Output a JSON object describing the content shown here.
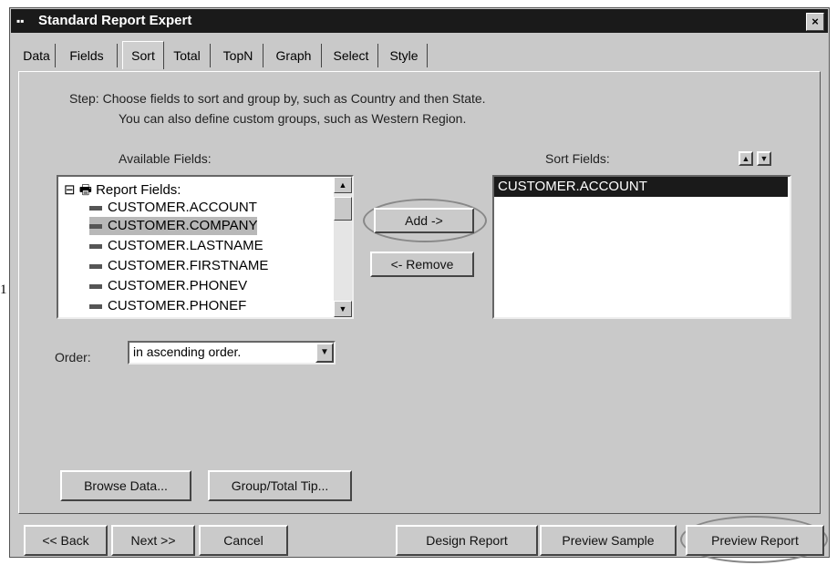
{
  "window": {
    "title": "Standard Report Expert",
    "close_label": "×"
  },
  "tabs": [
    "Data",
    "Fields",
    "Sort",
    "Total",
    "TopN",
    "Graph",
    "Select",
    "Style"
  ],
  "active_tab": "Sort",
  "step_text": {
    "line1": "Step:  Choose fields to sort and group by, such as Country and then State.",
    "line2": "You can also define custom groups, such as Western Region."
  },
  "available_fields": {
    "label": "Available Fields:",
    "root": "Report Fields:",
    "items": [
      "CUSTOMER.ACCOUNT",
      "CUSTOMER.COMPANY",
      "CUSTOMER.LASTNAME",
      "CUSTOMER.FIRSTNAME",
      "CUSTOMER.PHONEV",
      "CUSTOMER.PHONEF"
    ],
    "selected": "CUSTOMER.COMPANY"
  },
  "buttons": {
    "add": "Add ->",
    "remove": "<- Remove"
  },
  "sort_fields": {
    "label": "Sort Fields:",
    "items": [
      "CUSTOMER.ACCOUNT"
    ]
  },
  "order": {
    "label": "Order:",
    "value": "in ascending order."
  },
  "bottom_panel_buttons": {
    "browse": "Browse Data...",
    "group_tip": "Group/Total Tip..."
  },
  "footer": {
    "back": "<< Back",
    "next": "Next >>",
    "cancel": "Cancel",
    "design": "Design Report",
    "preview_sample": "Preview Sample",
    "preview_report": "Preview Report"
  },
  "stray_mark": "1"
}
